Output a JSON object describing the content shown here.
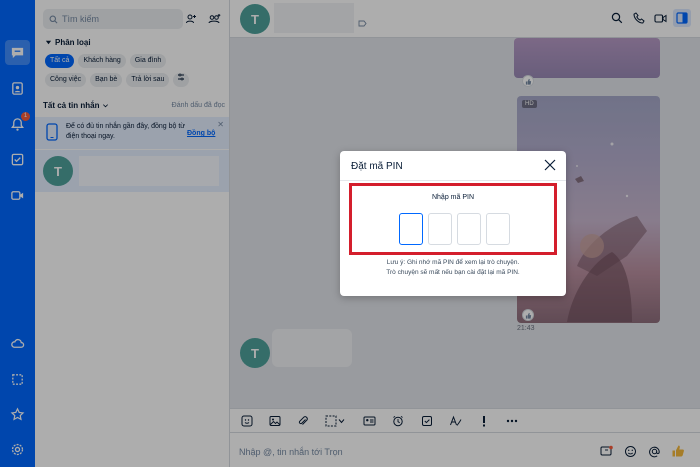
{
  "search": {
    "placeholder": "Tìm kiếm"
  },
  "categories": {
    "title": "Phân loại",
    "chips_row1": [
      "Tất cả",
      "Khách hàng",
      "Gia đình"
    ],
    "chips_row2": [
      "Công việc",
      "Bạn bè",
      "Trả lời sau"
    ]
  },
  "filter": {
    "label": "Tất cả tin nhắn",
    "mark_read": "Đánh dấu đã đọc"
  },
  "banner": {
    "text": "Để có đủ tin nhắn gần đây, đồng bộ từ điện thoại ngay.",
    "link": "Đồng bộ"
  },
  "notifications": {
    "badge": "1"
  },
  "conversation": {
    "avatar_letter": "T"
  },
  "chat": {
    "avatar_letter": "T",
    "hd_label": "HD",
    "time": "21:43",
    "composer_placeholder": "Nhập @, tin nhắn tới Trọn"
  },
  "modal": {
    "title": "Đặt mã PIN",
    "pin_label": "Nhập mã PIN",
    "note_line1": "Lưu ý: Ghi nhớ mã PIN để xem lại trò chuyện.",
    "note_line2": "Trò chuyện sẽ mất nếu bạn cài đặt lại mã PIN."
  },
  "colors": {
    "brand": "#0068ff",
    "highlight": "#d41e2c",
    "avatar": "#4ea19b"
  }
}
